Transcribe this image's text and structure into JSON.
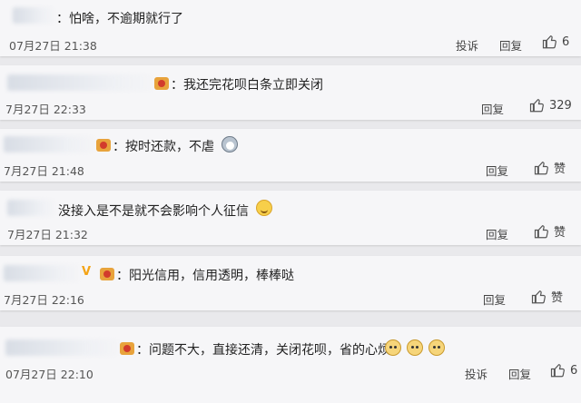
{
  "comments": [
    {
      "text": "：怕啥，不逾期就行了",
      "time": "07月27日 21:38",
      "report": "投诉",
      "reply": "回复",
      "likes": "6"
    },
    {
      "text": "我还完花呗白条立即关闭",
      "time": "7月27日 22:33",
      "reply": "回复",
      "likes": "329"
    },
    {
      "text": "按时还款，不虐",
      "time": "7月27日 21:48",
      "reply": "回复",
      "likes": "赞"
    },
    {
      "text": "没接入是不是就不会影响个人征信",
      "time": "7月27日 21:32",
      "reply": "回复",
      "likes": "赞"
    },
    {
      "text": "阳光信用，信用透明，棒棒哒",
      "time": "7月27日 22:16",
      "reply": "回复",
      "likes": "赞",
      "vmark": "V"
    },
    {
      "text": "问题不大，直接还清，关闭花呗，省的心烦",
      "time": "07月27日 22:10",
      "report": "投诉",
      "reply": "回复",
      "likes": "6"
    }
  ],
  "icons": {
    "like": "thumbs-up-icon",
    "badge": "medal-icon",
    "emoji": "dog-face-icon"
  }
}
